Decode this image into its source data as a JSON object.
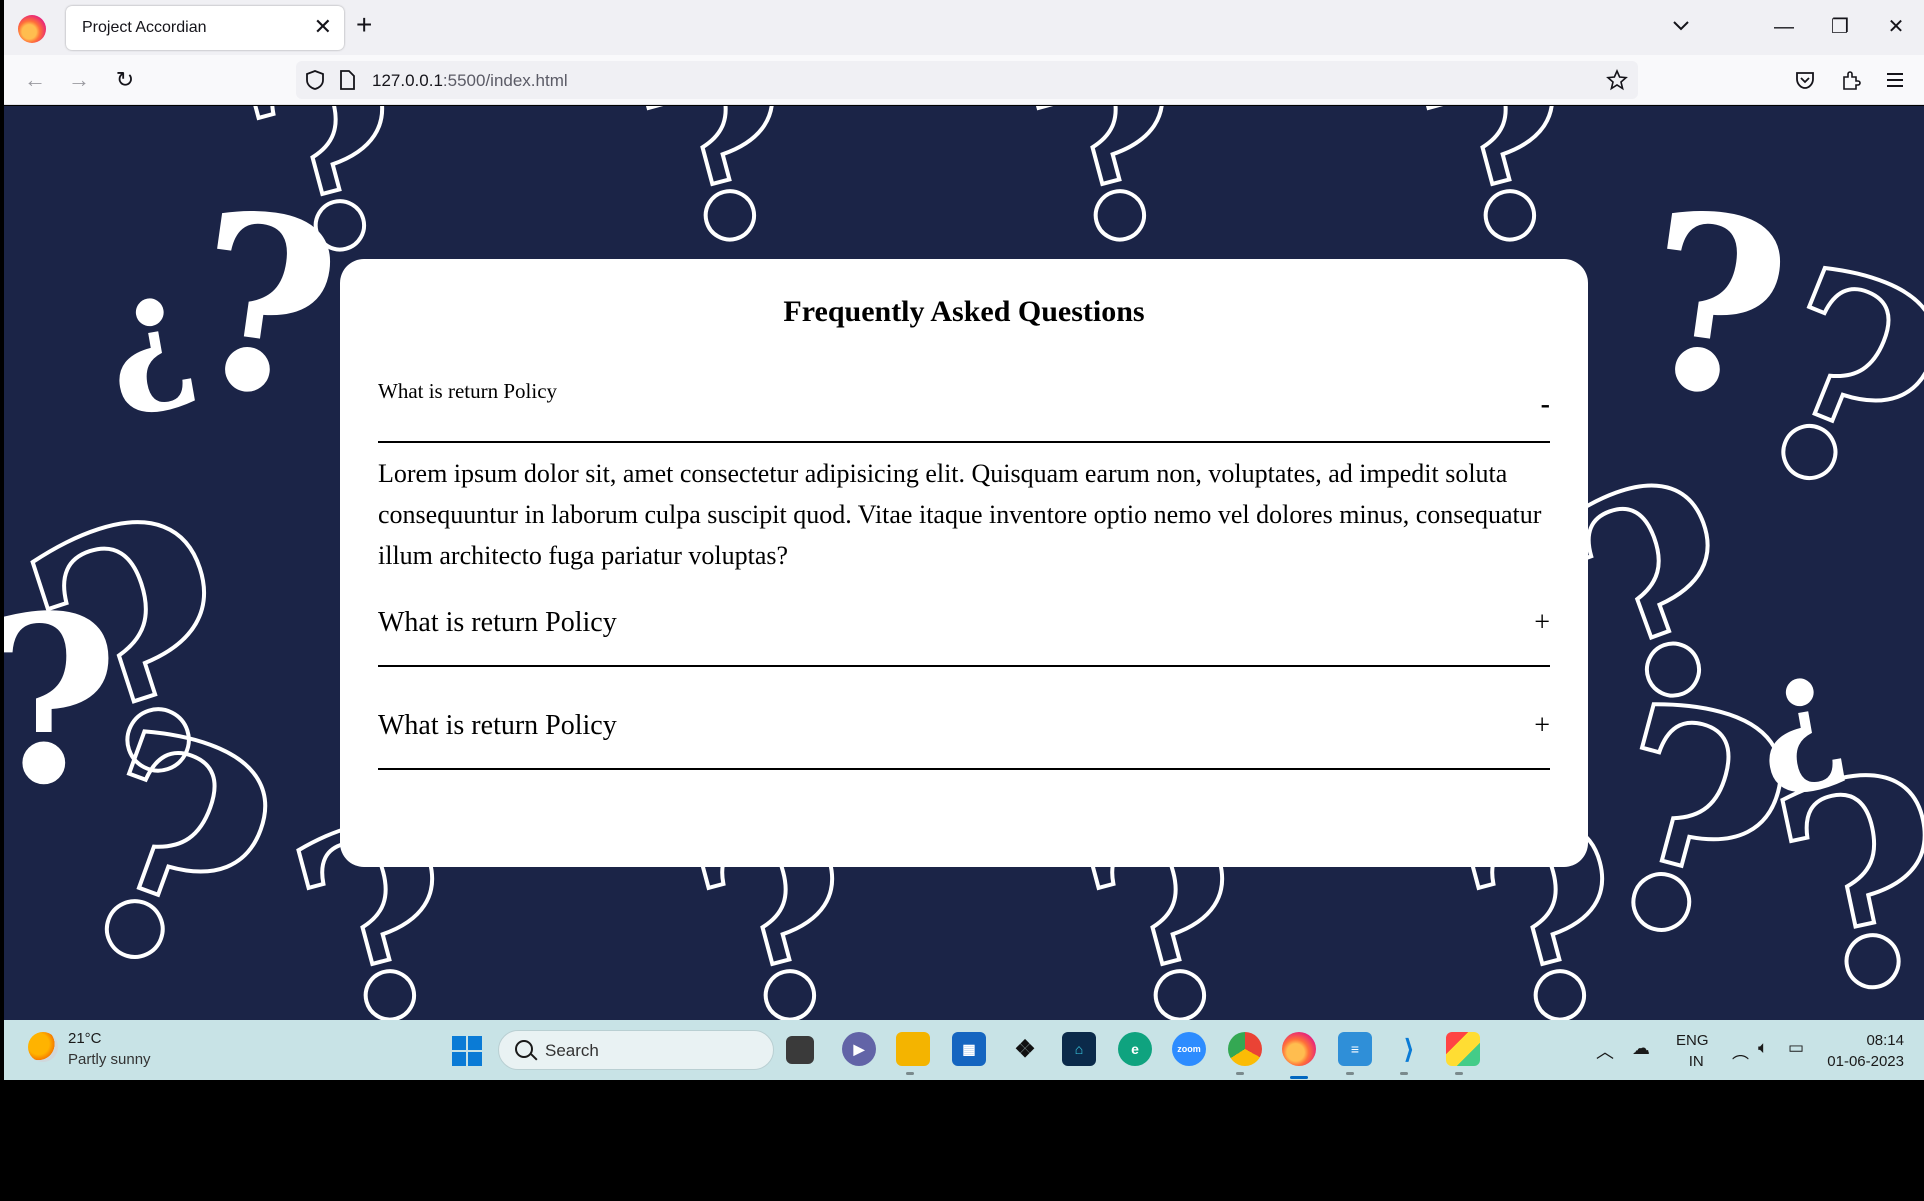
{
  "browser": {
    "tab_title": "Project Accordian",
    "url_host": "127.0.0.1",
    "url_rest": ":5500/index.html"
  },
  "faq": {
    "title": "Frequently Asked Questions",
    "items": [
      {
        "question": "What is return Policy",
        "sign": "-",
        "expanded": true,
        "answer": "Lorem ipsum dolor sit, amet consectetur adipisicing elit. Quisquam earum non, voluptates, ad impedit soluta consequuntur in laborum culpa suscipit quod. Vitae itaque inventore optio nemo vel dolores minus, consequatur illum architecto fuga pariatur voluptas?"
      },
      {
        "question": "What is return Policy",
        "sign": "+",
        "expanded": false
      },
      {
        "question": "What is return Policy",
        "sign": "+",
        "expanded": false
      }
    ]
  },
  "taskbar": {
    "weather_temp": "21°C",
    "weather_desc": "Partly sunny",
    "search_placeholder": "Search",
    "lang_top": "ENG",
    "lang_bottom": "IN",
    "time": "08:14",
    "date": "01-06-2023",
    "zoom_label": "zoom"
  },
  "colors": {
    "page_background": "#1b2447",
    "card": "#ffffff",
    "taskbar": "#c8e3e6"
  }
}
